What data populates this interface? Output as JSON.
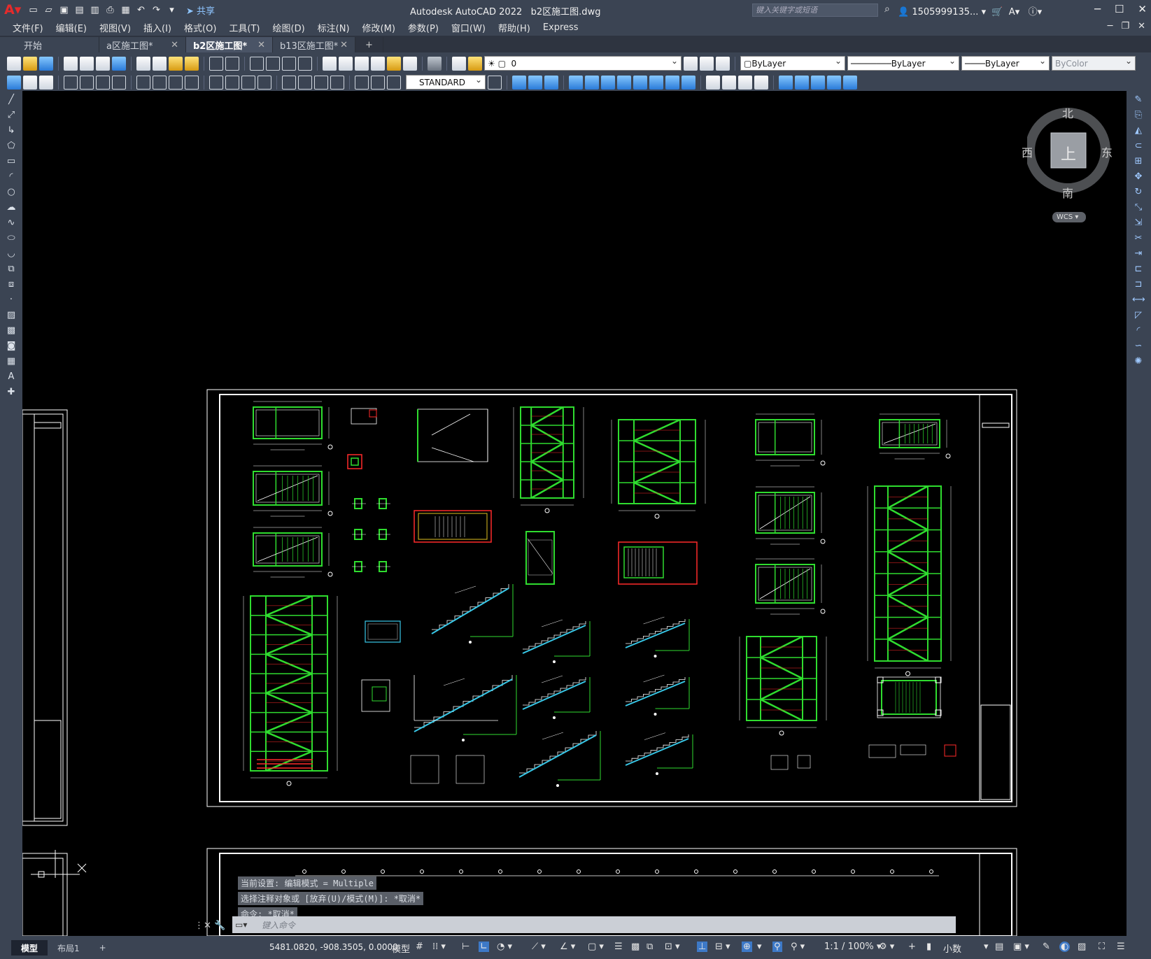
{
  "app": {
    "title": "Autodesk AutoCAD 2022",
    "file": "b2区施工图.dwg",
    "share": "共享",
    "search_placeholder": "键入关键字或短语",
    "user": "1505999135..."
  },
  "menu": [
    "文件(F)",
    "编辑(E)",
    "视图(V)",
    "插入(I)",
    "格式(O)",
    "工具(T)",
    "绘图(D)",
    "标注(N)",
    "修改(M)",
    "参数(P)",
    "窗口(W)",
    "帮助(H)",
    "Express"
  ],
  "tabs": [
    {
      "label": "开始",
      "active": false,
      "closable": false
    },
    {
      "label": "a区施工图*",
      "active": false,
      "closable": true
    },
    {
      "label": "b2区施工图*",
      "active": true,
      "closable": true
    },
    {
      "label": "b13区施工图*",
      "active": false,
      "closable": true
    }
  ],
  "toolbar": {
    "layer": "0",
    "color": "ByLayer",
    "linetype": "ByLayer",
    "lineweight": "ByLayer",
    "plotstyle": "ByColor",
    "textstyle": "STANDARD"
  },
  "viewcube": {
    "top": "上",
    "north": "北",
    "south": "南",
    "east": "东",
    "west": "西",
    "wcs": "WCS"
  },
  "command": {
    "line1": "当前设置: 编辑模式 = Multiple",
    "line2": "选择注释对象或 [放弃(U)/模式(M)]: *取消*",
    "line3": "命令: *取消*",
    "placeholder": "键入命令"
  },
  "status": {
    "layouts": [
      "模型",
      "布局1"
    ],
    "coords": "5481.0820, -908.3505, 0.0000",
    "model": "模型",
    "scale": "1:1 / 100%",
    "units": "小数"
  },
  "colors": {
    "green": "#2fdc2f",
    "white": "#ffffff",
    "red": "#ff2a2a",
    "cyan": "#38c8e8"
  }
}
